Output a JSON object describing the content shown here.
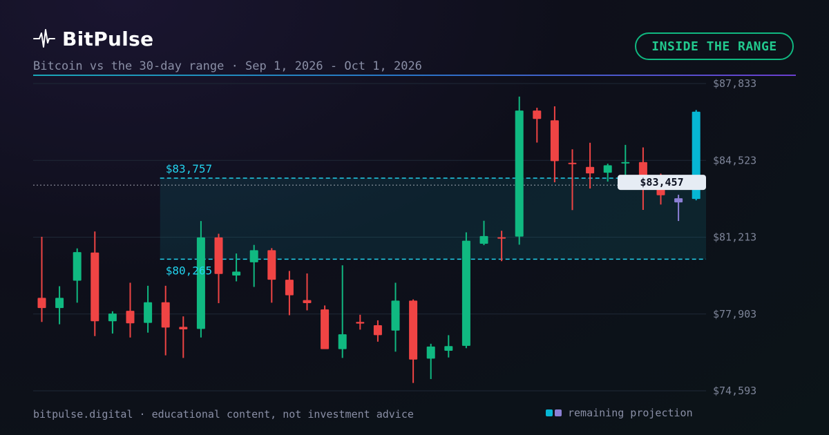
{
  "brand": {
    "name": "BitPulse"
  },
  "header": {
    "subtitle": "Bitcoin vs the 30-day range · Sep 1, 2026 - Oct 1, 2026",
    "badge": "INSIDE THE RANGE"
  },
  "footer": {
    "note": "bitpulse.digital · educational content, not investment advice",
    "legend_label": "remaining projection"
  },
  "colors": {
    "up": "#10b981",
    "down": "#ef4444",
    "projection_up": "#06b6d4",
    "projection_down": "#8b7fd4",
    "range": "#22d3ee",
    "current_tag_bg": "#e6ecf4"
  },
  "chart_data": {
    "type": "candlestick",
    "ylim": [
      74593,
      87833
    ],
    "y_ticks": [
      "$87,833",
      "$84,523",
      "$81,213",
      "$77,903",
      "$74,593"
    ],
    "y_tick_values": [
      87833,
      84523,
      81213,
      77903,
      74593
    ],
    "range": {
      "high": 83757,
      "low": 80265,
      "high_label": "$83,757",
      "low_label": "$80,265",
      "start_index": 7
    },
    "current_price": {
      "value": 83457,
      "label": "$83,457"
    },
    "candles": [
      {
        "o": 78600,
        "h": 81230,
        "l": 77560,
        "c": 78160
      },
      {
        "o": 78160,
        "h": 79100,
        "l": 77460,
        "c": 78600
      },
      {
        "o": 79340,
        "h": 80730,
        "l": 78390,
        "c": 80570
      },
      {
        "o": 80550,
        "h": 81460,
        "l": 76950,
        "c": 77590
      },
      {
        "o": 77590,
        "h": 78020,
        "l": 77060,
        "c": 77920
      },
      {
        "o": 78040,
        "h": 79250,
        "l": 76890,
        "c": 77500
      },
      {
        "o": 77520,
        "h": 79120,
        "l": 77100,
        "c": 78410
      },
      {
        "o": 78410,
        "h": 79120,
        "l": 76120,
        "c": 77320
      },
      {
        "o": 77350,
        "h": 77800,
        "l": 76010,
        "c": 77240
      },
      {
        "o": 77260,
        "h": 81910,
        "l": 76890,
        "c": 81200
      },
      {
        "o": 81200,
        "h": 81360,
        "l": 78370,
        "c": 79630
      },
      {
        "o": 79560,
        "h": 80510,
        "l": 79310,
        "c": 79730
      },
      {
        "o": 80130,
        "h": 80880,
        "l": 79070,
        "c": 80650
      },
      {
        "o": 80650,
        "h": 80740,
        "l": 78390,
        "c": 79380
      },
      {
        "o": 79380,
        "h": 79760,
        "l": 77850,
        "c": 78710
      },
      {
        "o": 78500,
        "h": 79650,
        "l": 78060,
        "c": 78370
      },
      {
        "o": 78100,
        "h": 78270,
        "l": 76530,
        "c": 76390
      },
      {
        "o": 76390,
        "h": 80000,
        "l": 76010,
        "c": 77030
      },
      {
        "o": 77560,
        "h": 77870,
        "l": 77230,
        "c": 77490
      },
      {
        "o": 77420,
        "h": 77630,
        "l": 76710,
        "c": 76990
      },
      {
        "o": 77190,
        "h": 79250,
        "l": 76280,
        "c": 78480
      },
      {
        "o": 78480,
        "h": 78530,
        "l": 74930,
        "c": 75940
      },
      {
        "o": 75980,
        "h": 76620,
        "l": 75100,
        "c": 76500
      },
      {
        "o": 76320,
        "h": 76990,
        "l": 76030,
        "c": 76520
      },
      {
        "o": 76530,
        "h": 81420,
        "l": 76430,
        "c": 81060
      },
      {
        "o": 80930,
        "h": 81920,
        "l": 80870,
        "c": 81260
      },
      {
        "o": 81210,
        "h": 81490,
        "l": 80180,
        "c": 81200
      },
      {
        "o": 81240,
        "h": 87270,
        "l": 80890,
        "c": 86670
      },
      {
        "o": 86670,
        "h": 86790,
        "l": 85290,
        "c": 86310
      },
      {
        "o": 86250,
        "h": 86850,
        "l": 83580,
        "c": 84490
      },
      {
        "o": 84420,
        "h": 85000,
        "l": 82380,
        "c": 84400
      },
      {
        "o": 84240,
        "h": 85280,
        "l": 83310,
        "c": 83960
      },
      {
        "o": 83990,
        "h": 84380,
        "l": 83610,
        "c": 84310
      },
      {
        "o": 84430,
        "h": 85190,
        "l": 83580,
        "c": 84450
      },
      {
        "o": 84450,
        "h": 85080,
        "l": 82390,
        "c": 83520
      },
      {
        "o": 83520,
        "h": 83950,
        "l": 82620,
        "c": 83020
      },
      {
        "o": 82890,
        "h": 83040,
        "l": 81910,
        "c": 82710,
        "projection": true
      },
      {
        "o": 82860,
        "h": 86690,
        "l": 82800,
        "c": 86620,
        "projection": true
      }
    ]
  }
}
